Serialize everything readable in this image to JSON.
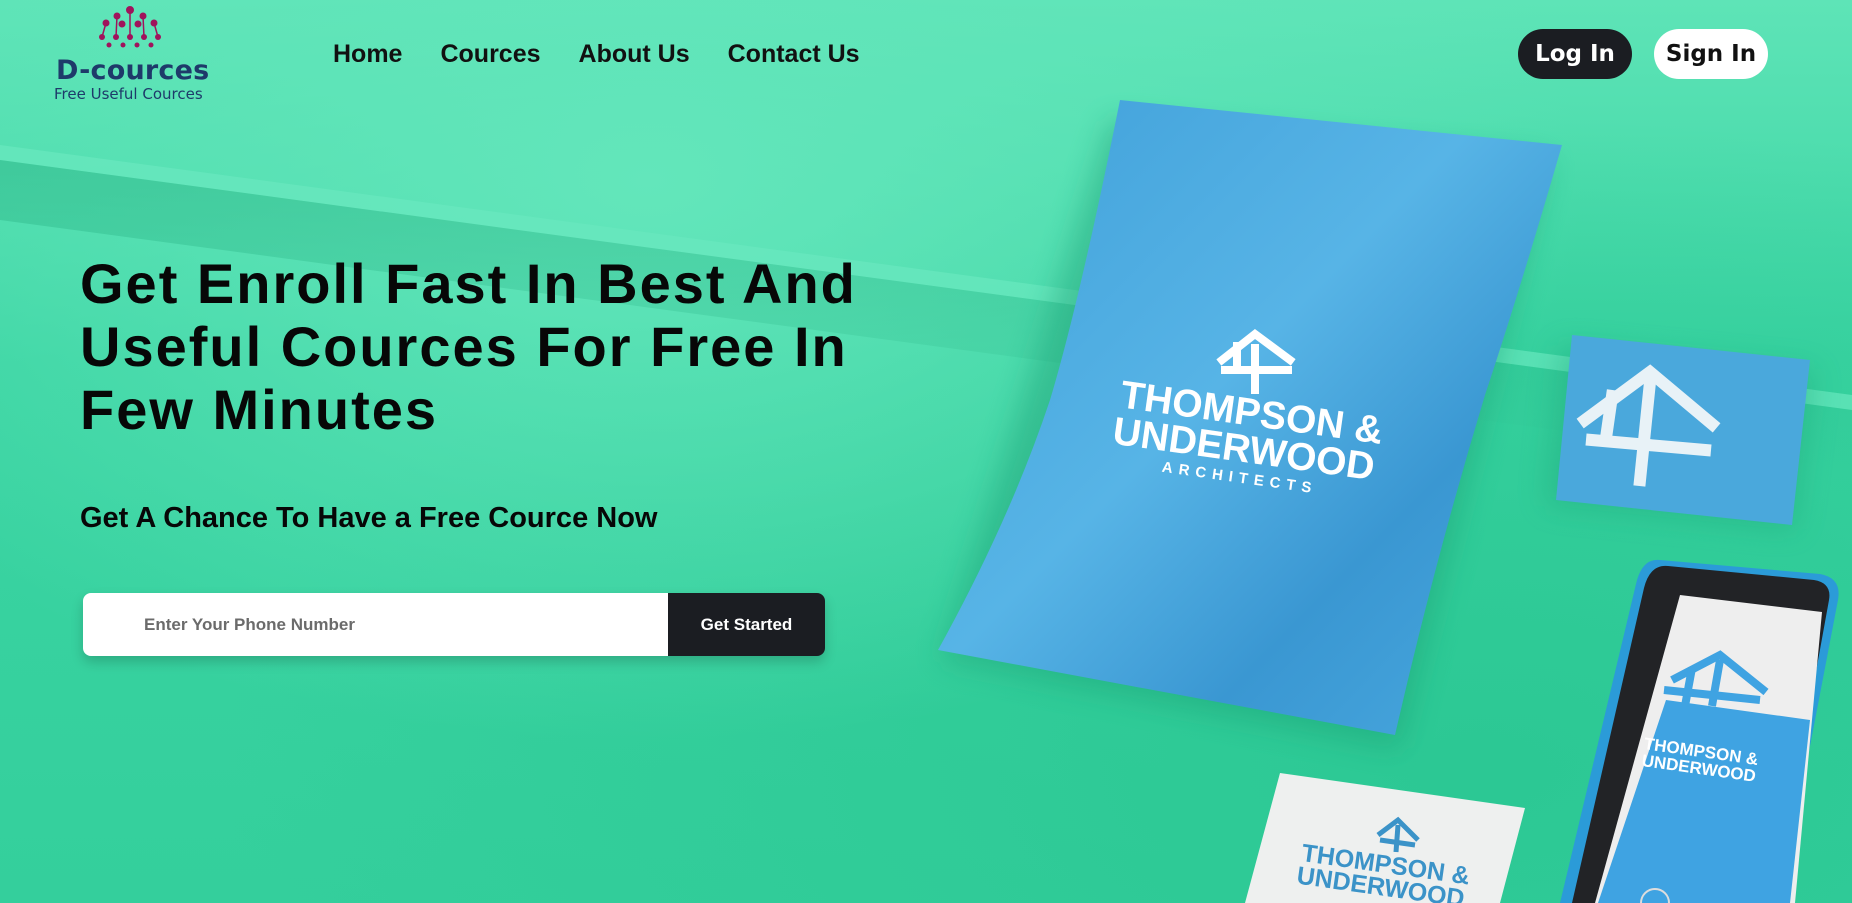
{
  "brand": {
    "name": "D-cources",
    "tagline": "Free Useful Cources"
  },
  "nav": {
    "items": [
      {
        "label": "Home"
      },
      {
        "label": "Cources"
      },
      {
        "label": "About Us"
      },
      {
        "label": "Contact Us"
      }
    ]
  },
  "auth": {
    "login_label": "Log In",
    "signin_label": "Sign In"
  },
  "hero": {
    "headline_lines": [
      "Get Enroll Fast In Best And",
      "Useful Cources For Free In",
      "Few Minutes"
    ],
    "subheadline": "Get A Chance To Have a Free Cource Now",
    "phone_placeholder": "Enter Your Phone Number",
    "cta_label": "Get Started"
  },
  "mockup": {
    "brand_line1": "THOMPSON &",
    "brand_line2": "UNDERWOOD",
    "brand_line3": "ARCHITECTS"
  },
  "colors": {
    "background": "#39d1a0",
    "dark": "#1b1d22",
    "logo_text": "#1e3a6a",
    "logo_dots": "#a0135c",
    "paper_blue": "#3fa6e0"
  }
}
